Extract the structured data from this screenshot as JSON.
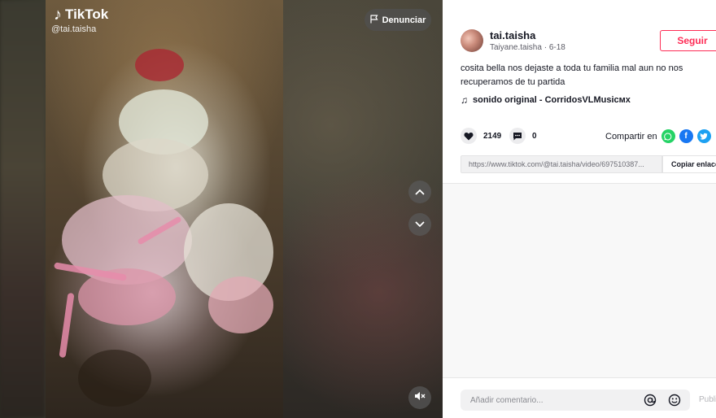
{
  "video": {
    "logo_text": "TikTok",
    "watermark_user": "@tai.taisha",
    "report_label": "Denunciar"
  },
  "author": {
    "username": "tai.taisha",
    "subline": "Taiyane.taisha · 6-18",
    "follow_label": "Seguir"
  },
  "post": {
    "description": "cosita bella nos dejaste a toda tu familia mal aun no nos recuperamos de tu partida",
    "music": "sonido original - CorridosVLMusicмx",
    "likes": "2149",
    "comments": "0",
    "share_label": "Compartir en",
    "link_url": "https://www.tiktok.com/@tai.taisha/video/697510387...",
    "copy_label": "Copiar enlace"
  },
  "comment_box": {
    "placeholder": "Añadir comentario...",
    "publish_label": "Publicar"
  },
  "colors": {
    "accent": "#fe2c55",
    "whatsapp": "#25d366",
    "facebook": "#1877f2",
    "twitter": "#1da1f2"
  }
}
